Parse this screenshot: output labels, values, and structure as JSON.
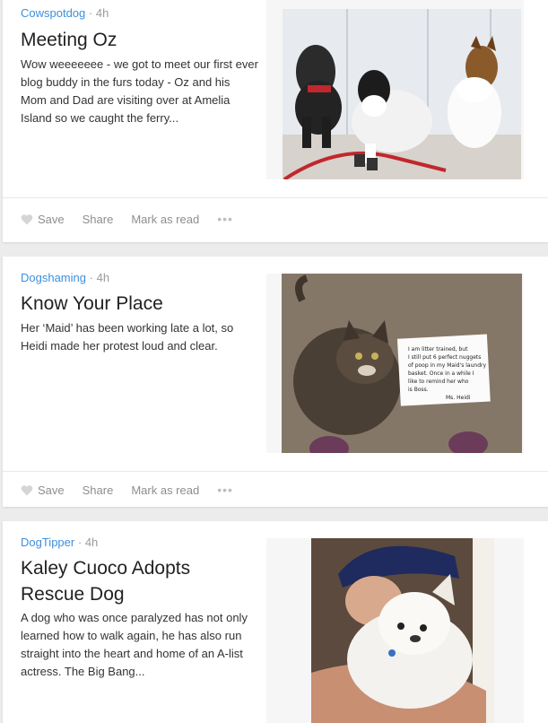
{
  "feed": {
    "items": [
      {
        "source": "Cowspotdog",
        "separator": "·",
        "age": "4h",
        "title": "Meeting Oz",
        "excerpt": "Wow weeeeeee - we got to meet our first ever blog buddy in the furs today - Oz and his Mom and Dad are visiting over at Amelia Island so we caught the ferry...",
        "image": "photo-three-dogs-sitting"
      },
      {
        "source": "Dogshaming",
        "separator": "·",
        "age": "4h",
        "title": "Know Your Place",
        "excerpt": "Her ‘Maid’ has been working late a lot, so Heidi made her protest loud and clear.",
        "image": "photo-cat-with-sign",
        "sign_lines": [
          "I am litter trained, but",
          "I still put 6 perfect nuggets",
          "of poop in my Maid's laundry",
          "basket. Once in a while I",
          "like to remind her who",
          "is Boss.",
          "Ms. Heidi"
        ]
      },
      {
        "source": "DogTipper",
        "separator": "·",
        "age": "4h",
        "title": "Kaley Cuoco Adopts Rescue Dog",
        "excerpt": "A dog who was once paralyzed has not only learned how to walk again, he has also run straight into the heart and home of an A-list actress. The Big Bang...",
        "image": "photo-woman-hugging-white-dog"
      }
    ]
  },
  "actions": {
    "save": "Save",
    "share": "Share",
    "mark_as_read": "Mark as read",
    "more": "•••"
  },
  "colors": {
    "source_link": "#3d8fdc",
    "meta_gray": "#9a9a9a",
    "action_gray": "#8e8e8e",
    "background": "#ececec"
  }
}
